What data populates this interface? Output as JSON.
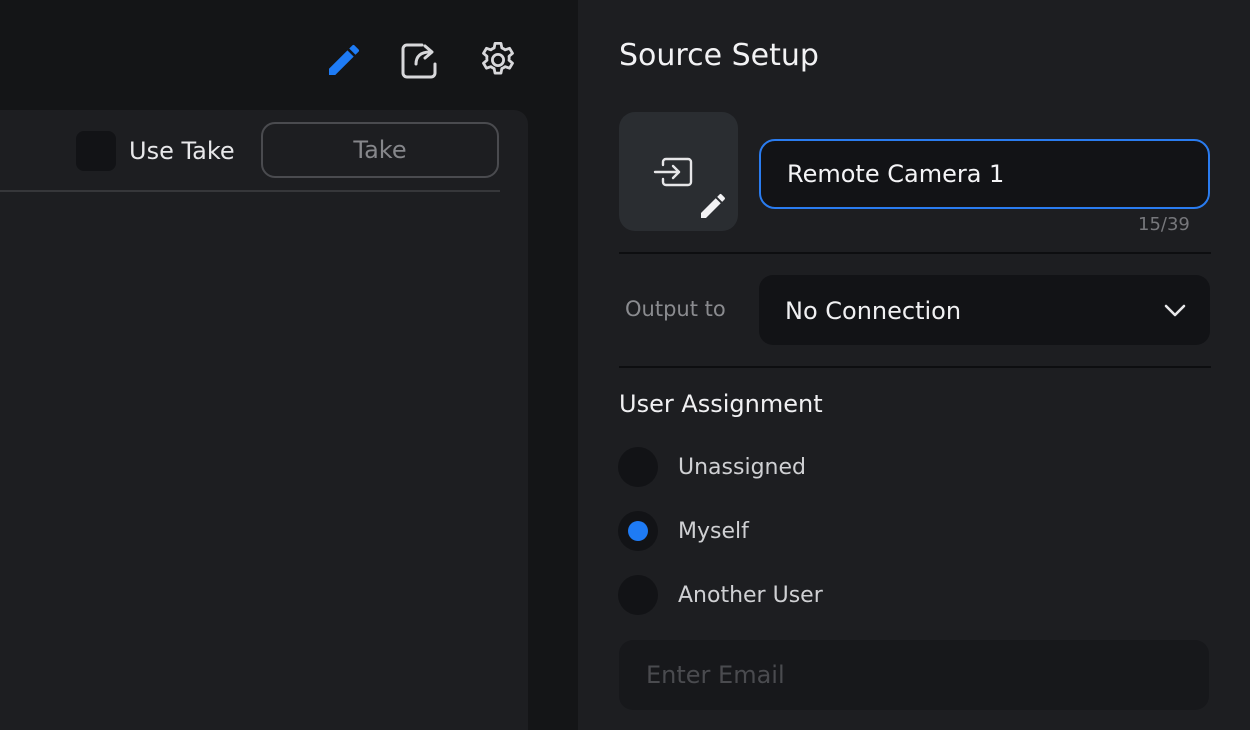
{
  "colors": {
    "accent": "#1e7bf5",
    "background": "#141517",
    "panel": "#1d1e21"
  },
  "toolbar": {
    "edit_icon": "pencil-icon",
    "share_icon": "share-icon",
    "settings_icon": "gear-icon"
  },
  "take": {
    "checkbox_label": "Use Take",
    "button_label": "Take"
  },
  "source_setup": {
    "title": "Source Setup",
    "source_icon": "input-source-icon",
    "edit_icon": "pencil-icon",
    "name_value": "Remote Camera 1",
    "char_count": "15/39",
    "output_label": "Output to",
    "output_value": "No Connection",
    "user_assignment": {
      "title": "User Assignment",
      "options": [
        "Unassigned",
        "Myself",
        "Another User"
      ],
      "selected": "Myself"
    },
    "email_placeholder": "Enter Email"
  }
}
